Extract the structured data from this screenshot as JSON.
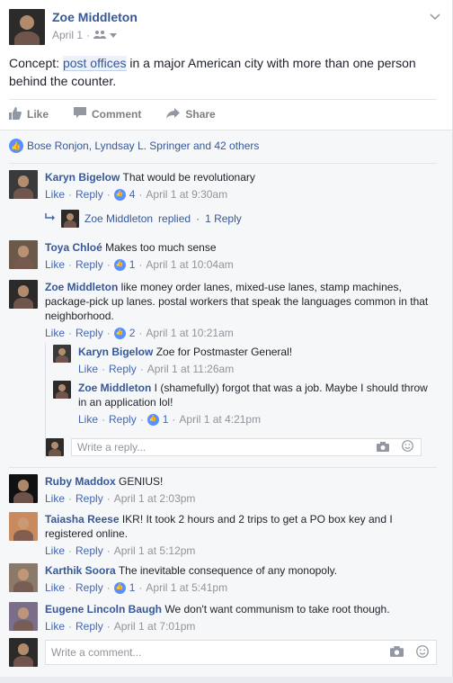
{
  "post": {
    "author": "Zoe Middleton",
    "date": "April 1",
    "privacy_icon": "friends-icon",
    "text_before": "Concept: ",
    "text_highlight": "post offices",
    "text_after": " in a major American city with more than one person behind the counter."
  },
  "actions": {
    "like": "Like",
    "comment": "Comment",
    "share": "Share"
  },
  "likes_summary": "Bose Ronjon, Lyndsay L. Springer and 42 others",
  "link_labels": {
    "like": "Like",
    "reply": "Reply",
    "sep": "·"
  },
  "comments": [
    {
      "name": "Karyn Bigelow",
      "text": "That would be revolutionary",
      "likes": "4",
      "time": "April 1 at 9:30am"
    },
    {
      "name": "Toya Chloé",
      "text": "Makes too much sense",
      "likes": "1",
      "time": "April 1 at 10:04am"
    },
    {
      "name": "Zoe Middleton",
      "text": "like money order lanes, mixed-use lanes, stamp machines, package-pick up lanes. postal workers that speak the languages common in that neighborhood.",
      "likes": "2",
      "time": "April 1 at 10:21am"
    },
    {
      "name": "Ruby Maddox",
      "text": "GENIUS!",
      "time": "April 1 at 2:03pm"
    },
    {
      "name": "Taiasha Reese",
      "text": "IKR! It took 2 hours and 2 trips to get a PO box key and I registered online.",
      "time": "April 1 at 5:12pm"
    },
    {
      "name": "Karthik Soora",
      "text": "The inevitable consequence of any monopoly.",
      "likes": "1",
      "time": "April 1 at 5:41pm"
    },
    {
      "name": "Eugene Lincoln Baugh",
      "text": "We don't want communism to take root though.",
      "time": "April 1 at 7:01pm"
    }
  ],
  "reply_summary": {
    "name": "Zoe Middleton",
    "action": "replied",
    "count": "1 Reply"
  },
  "replies": [
    {
      "name": "Karyn Bigelow",
      "text": "Zoe for Postmaster General!",
      "time": "April 1 at 11:26am"
    },
    {
      "name": "Zoe Middleton",
      "text": "I (shamefully) forgot that was a job. Maybe I should throw in an application lol!",
      "likes": "1",
      "time": "April 1 at 4:21pm"
    }
  ],
  "reply_placeholder": "Write a reply...",
  "comment_placeholder": "Write a comment...",
  "colors": {
    "link": "#365899",
    "accent": "#5890ff",
    "muted": "#90949c"
  }
}
